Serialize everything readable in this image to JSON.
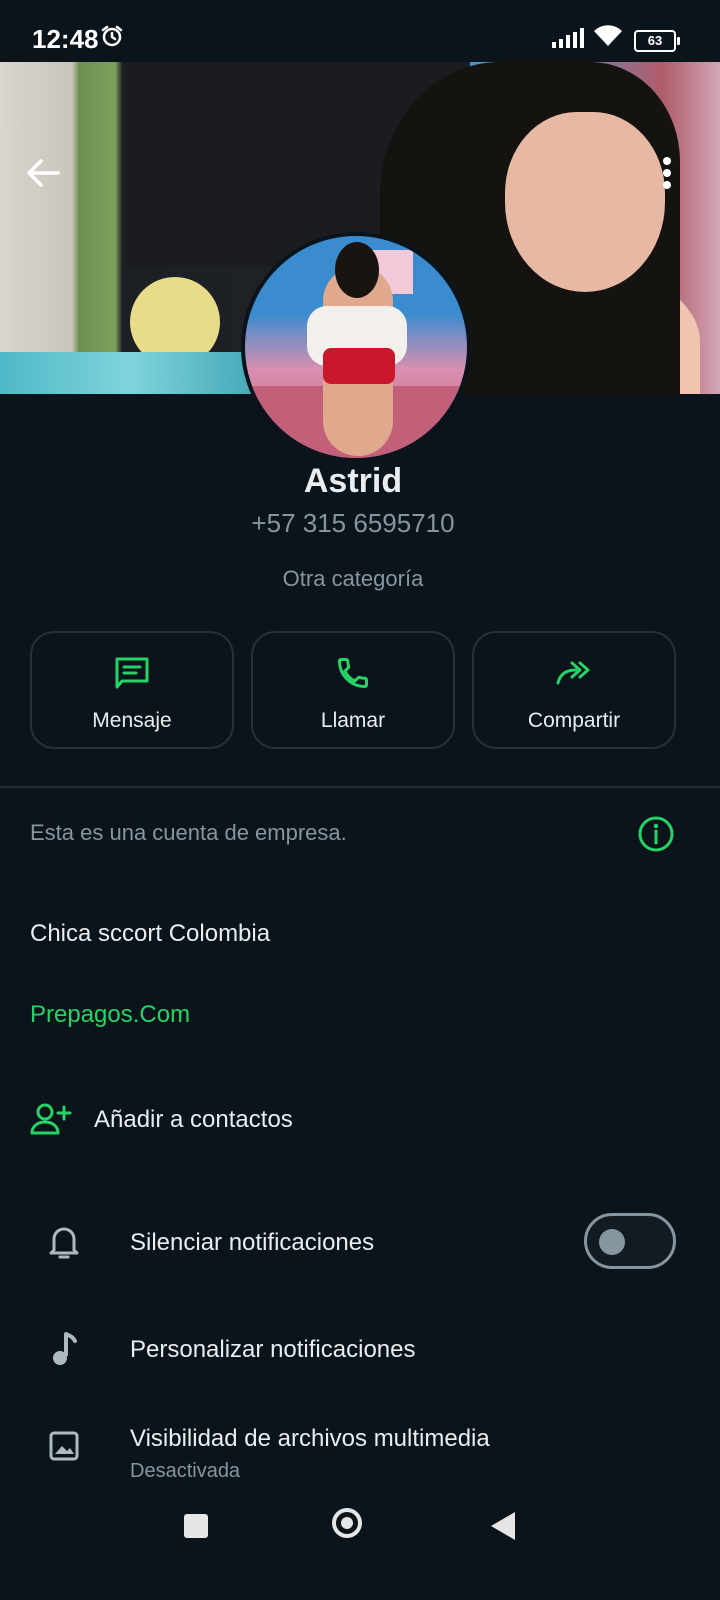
{
  "status_bar": {
    "time": "12:48",
    "battery": "63",
    "icons": [
      "alarm-icon",
      "signal-icon",
      "wifi-icon",
      "battery-icon"
    ]
  },
  "header": {
    "back_icon": "arrow-left-icon",
    "menu_icon": "more-vertical-icon"
  },
  "profile": {
    "name": "Astrid",
    "phone": "+57 315 6595710",
    "category": "Otra categoría"
  },
  "actions": [
    {
      "label": "Mensaje",
      "icon": "message-icon"
    },
    {
      "label": "Llamar",
      "icon": "phone-icon"
    },
    {
      "label": "Compartir",
      "icon": "share-icon"
    }
  ],
  "business": {
    "notice": "Esta es una cuenta de empresa.",
    "description": "Chica sccort Colombia",
    "link": "Prepagos.Com"
  },
  "add_contact": {
    "label": "Añadir a contactos",
    "icon": "add-contact-icon"
  },
  "settings": {
    "mute": {
      "label": "Silenciar notificaciones",
      "enabled": false
    },
    "custom_notifications": {
      "label": "Personalizar notificaciones"
    },
    "media_visibility": {
      "label": "Visibilidad de archivos multimedia",
      "value": "Desactivada"
    }
  },
  "colors": {
    "background": "#0b141a",
    "accent": "#25d366",
    "text_primary": "#e9edef",
    "text_secondary": "#8696a0"
  }
}
